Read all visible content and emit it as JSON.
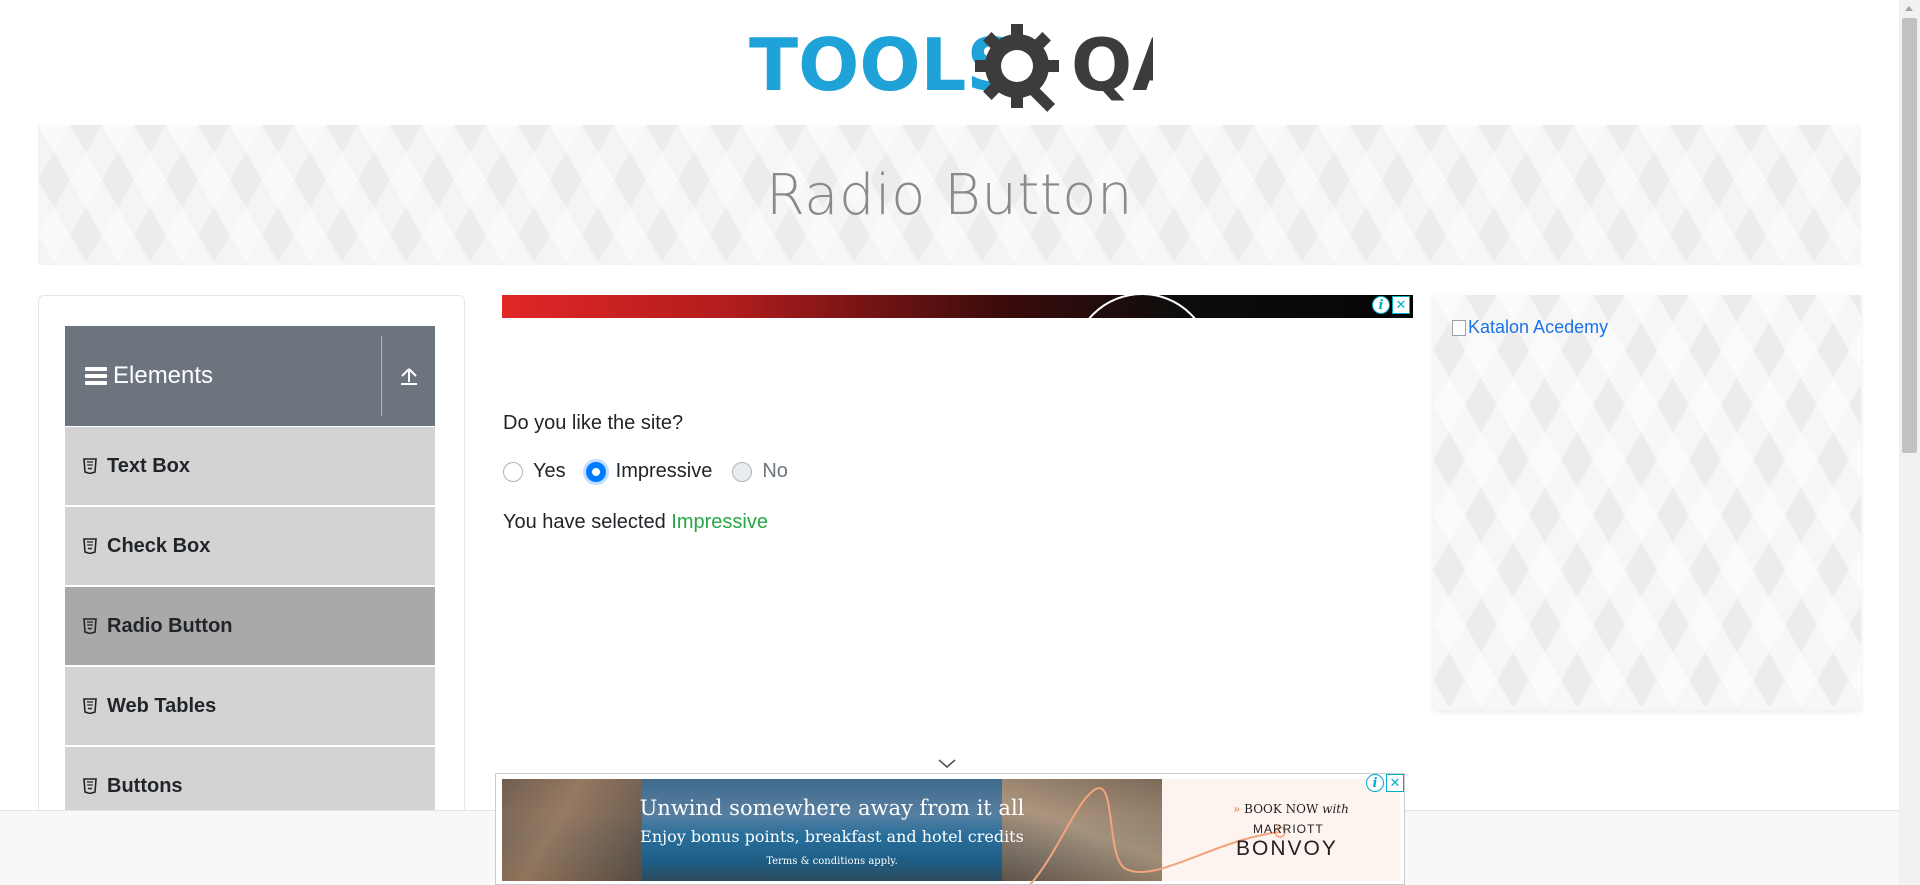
{
  "logo": {
    "text_tools": "TOOLS",
    "text_qa": "QA",
    "icon": "gear-magnifier-logo-icon"
  },
  "banner": {
    "title": "Radio Button"
  },
  "sidebar": {
    "group_title": "Elements",
    "menu_icon": "hamburger-icon",
    "collapse_icon": "upload-arrow-icon",
    "items": [
      {
        "label": "Text Box",
        "icon": "html5-icon",
        "active": false
      },
      {
        "label": "Check Box",
        "icon": "html5-icon",
        "active": false
      },
      {
        "label": "Radio Button",
        "icon": "html5-icon",
        "active": true
      },
      {
        "label": "Web Tables",
        "icon": "html5-icon",
        "active": false
      },
      {
        "label": "Buttons",
        "icon": "html5-icon",
        "active": false
      }
    ]
  },
  "main": {
    "question": "Do you like the site?",
    "options": [
      {
        "label": "Yes",
        "checked": false,
        "disabled": false
      },
      {
        "label": "Impressive",
        "checked": true,
        "disabled": false
      },
      {
        "label": "No",
        "checked": false,
        "disabled": true
      }
    ],
    "result_prefix": "You have selected ",
    "result_value": "Impressive"
  },
  "right_ad": {
    "alt_text": "Katalon Acedemy"
  },
  "ads": {
    "info_glyph": "i",
    "close_glyph": "✕"
  },
  "bottom_ad": {
    "headline": "Unwind somewhere away from it all",
    "subline": "Enjoy bonus points, breakfast and hotel credits",
    "terms": "Terms & conditions apply.",
    "book_arrow": "»",
    "book_text": "BOOK NOW",
    "book_with": "with",
    "brand_top": "MARRIOTT",
    "brand_main": "BONVOY"
  },
  "colors": {
    "primary": "#007bff",
    "success": "#28a745",
    "sidebar_header": "#6c757d",
    "logo_blue": "#1ea2d8",
    "logo_dark": "#3c3c3c"
  }
}
